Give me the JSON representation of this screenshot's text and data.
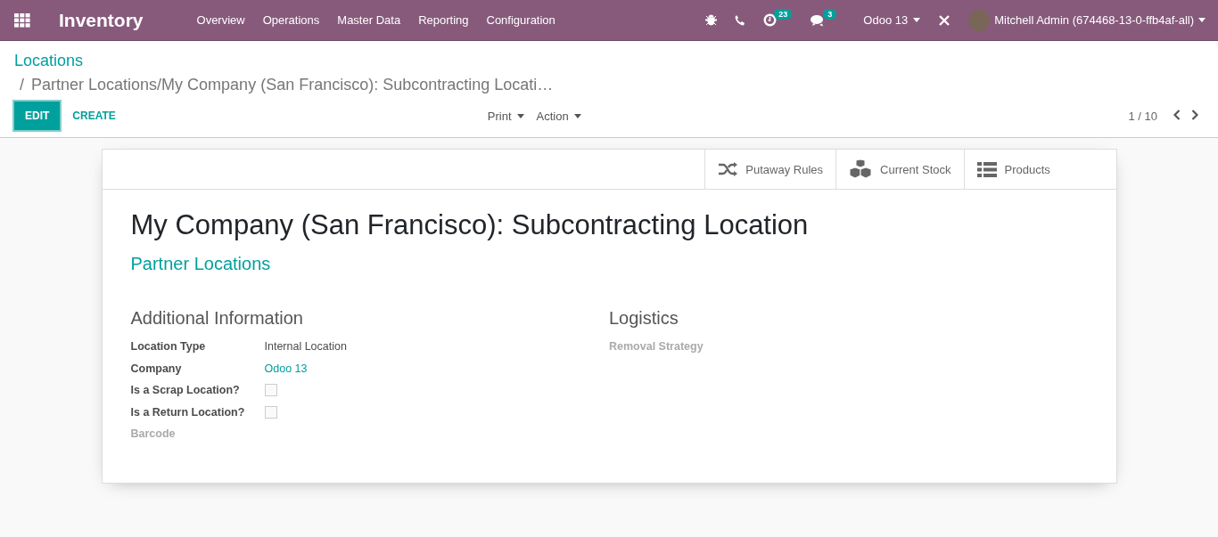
{
  "navbar": {
    "app_name": "Inventory",
    "menu": [
      "Overview",
      "Operations",
      "Master Data",
      "Reporting",
      "Configuration"
    ],
    "activity_count": "23",
    "message_count": "3",
    "company": "Odoo 13",
    "user": "Mitchell Admin (674468-13-0-ffb4af-all)"
  },
  "breadcrumb": {
    "parent": "Locations",
    "separator": "/",
    "current": "Partner Locations/My Company (San Francisco): Subcontracting Locati…"
  },
  "buttons": {
    "edit": "EDIT",
    "create": "CREATE",
    "print": "Print",
    "action": "Action"
  },
  "pager": "1 / 10",
  "smart_buttons": [
    {
      "kind": "shuffle",
      "label": "Putaway Rules"
    },
    {
      "kind": "cubes",
      "label": "Current Stock"
    },
    {
      "kind": "list",
      "label": "Products"
    }
  ],
  "title": "My Company (San Francisco): Subcontracting Location",
  "subtitle": "Partner Locations",
  "groups": [
    {
      "title": "Additional Information",
      "fields": [
        {
          "label": "Location Type",
          "kind": "text",
          "value": "Internal Location"
        },
        {
          "label": "Company",
          "kind": "link",
          "value": "Odoo 13"
        },
        {
          "label": "Is a Scrap Location?",
          "kind": "checkbox",
          "checked": false
        },
        {
          "label": "Is a Return Location?",
          "kind": "checkbox",
          "checked": false
        },
        {
          "label": "Barcode",
          "kind": "empty"
        }
      ]
    },
    {
      "title": "Logistics",
      "fields": [
        {
          "label": "Removal Strategy",
          "kind": "empty"
        }
      ]
    }
  ]
}
